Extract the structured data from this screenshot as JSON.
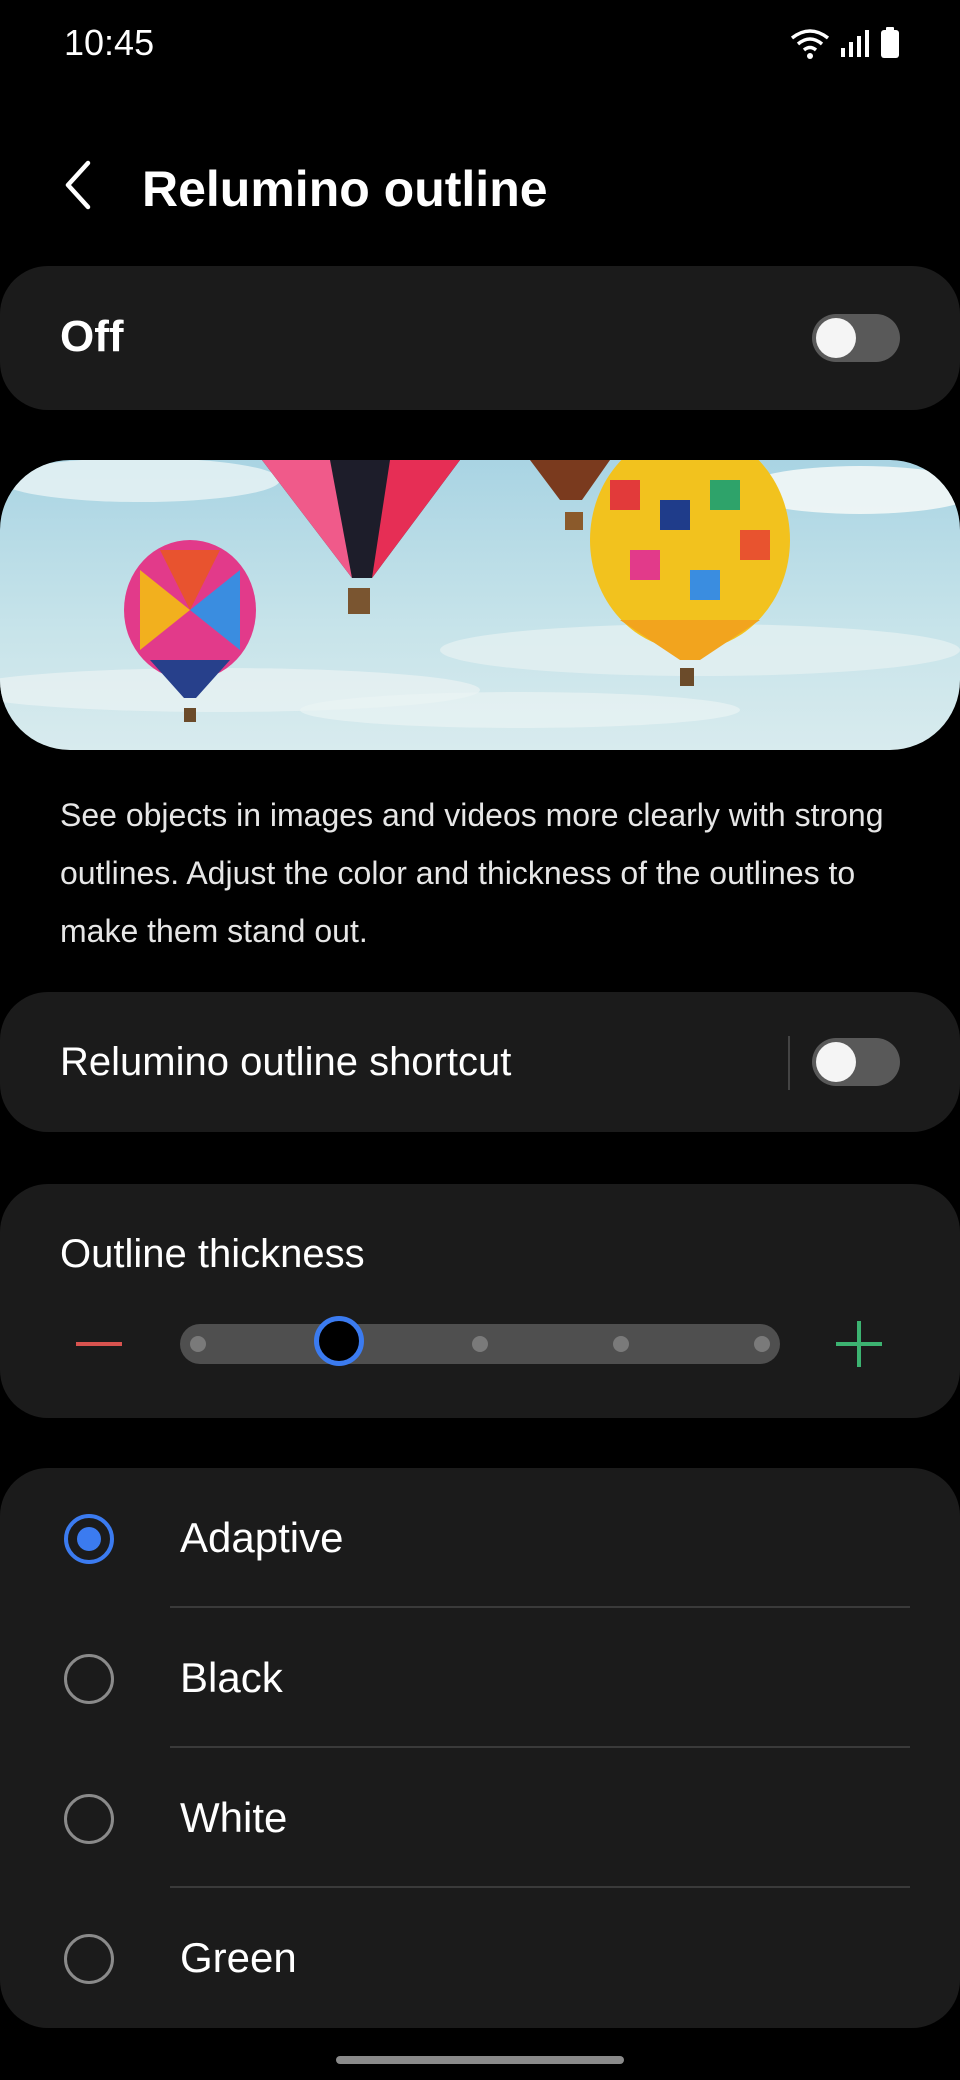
{
  "status_bar": {
    "time": "10:45"
  },
  "header": {
    "title": "Relumino outline"
  },
  "master": {
    "label": "Off",
    "enabled": false
  },
  "description": "See objects in images and videos more clearly with strong outlines. Adjust the color and thickness of the outlines to make them stand out.",
  "shortcut": {
    "label": "Relumino outline shortcut",
    "enabled": false
  },
  "thickness": {
    "label": "Outline thickness",
    "steps": 5,
    "selected_step": 2
  },
  "colors": {
    "options": [
      {
        "label": "Adaptive",
        "selected": true
      },
      {
        "label": "Black",
        "selected": false
      },
      {
        "label": "White",
        "selected": false
      },
      {
        "label": "Green",
        "selected": false
      }
    ]
  },
  "theme": {
    "accent": "#3b7bf0",
    "minus": "#d9534f",
    "plus": "#3cb371"
  }
}
